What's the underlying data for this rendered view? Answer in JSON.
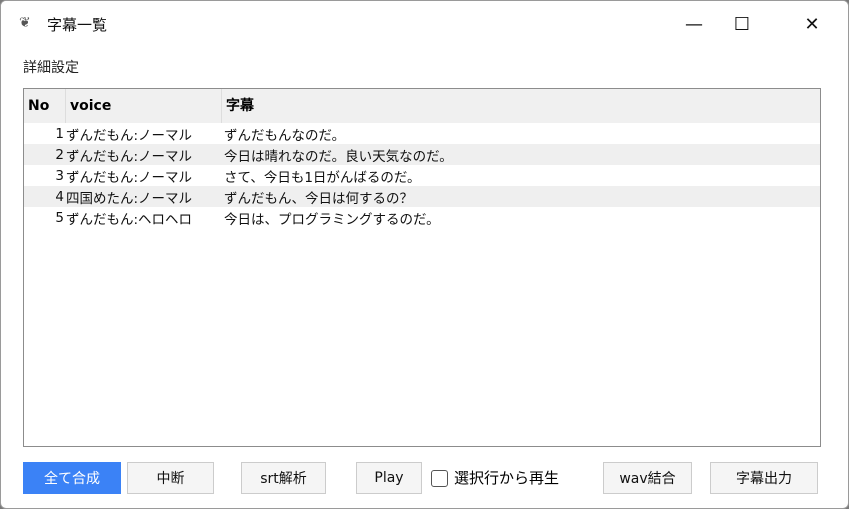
{
  "window": {
    "title": "字幕一覧",
    "icon": "app-icon"
  },
  "menu": {
    "settings": "詳細設定"
  },
  "table": {
    "headers": [
      "No",
      "voice",
      "字幕"
    ],
    "rows": [
      {
        "no": "1",
        "voice": "ずんだもん:ノーマル",
        "text": "ずんだもんなのだ。"
      },
      {
        "no": "2",
        "voice": "ずんだもん:ノーマル",
        "text": "今日は晴れなのだ。良い天気なのだ。"
      },
      {
        "no": "3",
        "voice": "ずんだもん:ノーマル",
        "text": "さて、今日も1日がんばるのだ。"
      },
      {
        "no": "4",
        "voice": "四国めたん:ノーマル",
        "text": "ずんだもん、今日は何するの？"
      },
      {
        "no": "5",
        "voice": "ずんだもん:ヘロヘロ",
        "text": "今日は、プログラミングするのだ。"
      }
    ]
  },
  "buttons": {
    "synth_all": "全て合成",
    "abort": "中断",
    "srt": "srt解析",
    "play": "Play",
    "play_from_selected": "選択行から再生",
    "wav_join": "wav結合",
    "export": "字幕出力"
  },
  "colors": {
    "primary": "#3b82f6"
  }
}
